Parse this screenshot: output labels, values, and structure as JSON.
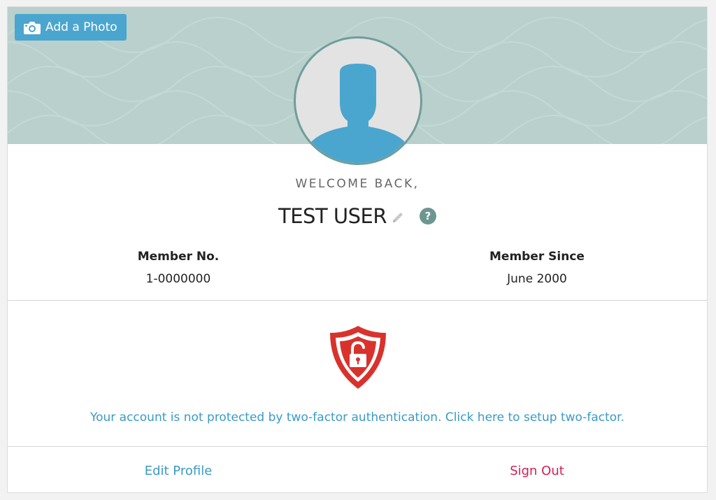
{
  "header": {
    "add_photo_label": "Add a Photo"
  },
  "profile": {
    "welcome_text": "WELCOME BACK,",
    "user_name": "TEST USER",
    "help_glyph": "?"
  },
  "membership": {
    "member_no_label": "Member No.",
    "member_no_value": "1-0000000",
    "member_since_label": "Member Since",
    "member_since_value": "June 2000"
  },
  "security": {
    "message": "Your account is not protected by two-factor authentication. Click here to setup two-factor.",
    "icon": "unlocked-shield-icon"
  },
  "footer": {
    "edit_profile_label": "Edit Profile",
    "sign_out_label": "Sign Out"
  },
  "colors": {
    "banner": "#b9d0cd",
    "accent_blue": "#4aa6cf",
    "link_blue": "#3a9ac6",
    "sign_out_red": "#d21f55",
    "shield_red": "#d9322c",
    "help_badge": "#6e9691"
  }
}
